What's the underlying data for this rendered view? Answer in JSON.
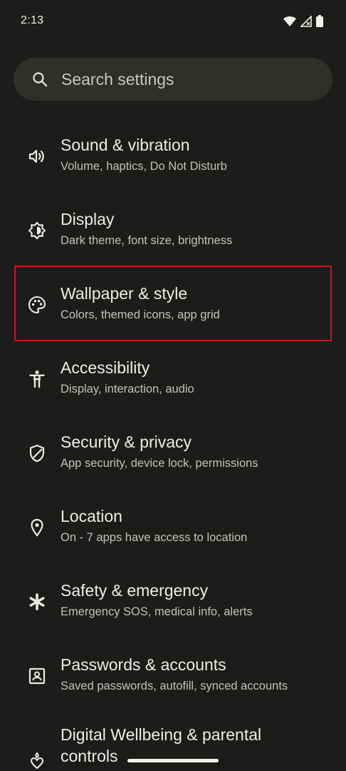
{
  "status_bar": {
    "time": "2:13",
    "icons": [
      "wifi-icon",
      "signal-icon",
      "battery-icon"
    ]
  },
  "search": {
    "placeholder": "Search settings",
    "icon": "search-icon"
  },
  "settings_items": [
    {
      "title": "Sound & vibration",
      "subtitle": "Volume, haptics, Do Not Disturb",
      "icon": "volume-icon"
    },
    {
      "title": "Display",
      "subtitle": "Dark theme, font size, brightness",
      "icon": "brightness-icon"
    },
    {
      "title": "Wallpaper & style",
      "subtitle": "Colors, themed icons, app grid",
      "icon": "palette-icon"
    },
    {
      "title": "Accessibility",
      "subtitle": "Display, interaction, audio",
      "icon": "accessibility-icon"
    },
    {
      "title": "Security & privacy",
      "subtitle": "App security, device lock, permissions",
      "icon": "shield-icon"
    },
    {
      "title": "Location",
      "subtitle": "On - 7 apps have access to location",
      "icon": "location-pin-icon"
    },
    {
      "title": "Safety & emergency",
      "subtitle": "Emergency SOS, medical info, alerts",
      "icon": "asterisk-icon"
    },
    {
      "title": "Passwords & accounts",
      "subtitle": "Saved passwords, autofill, synced accounts",
      "icon": "account-box-icon"
    },
    {
      "title": "Digital Wellbeing & parental controls",
      "icon": "wellbeing-icon"
    }
  ],
  "colors": {
    "background": "#1c1d1a",
    "search_background": "#2f302c",
    "highlight_border": "#d1141b"
  }
}
